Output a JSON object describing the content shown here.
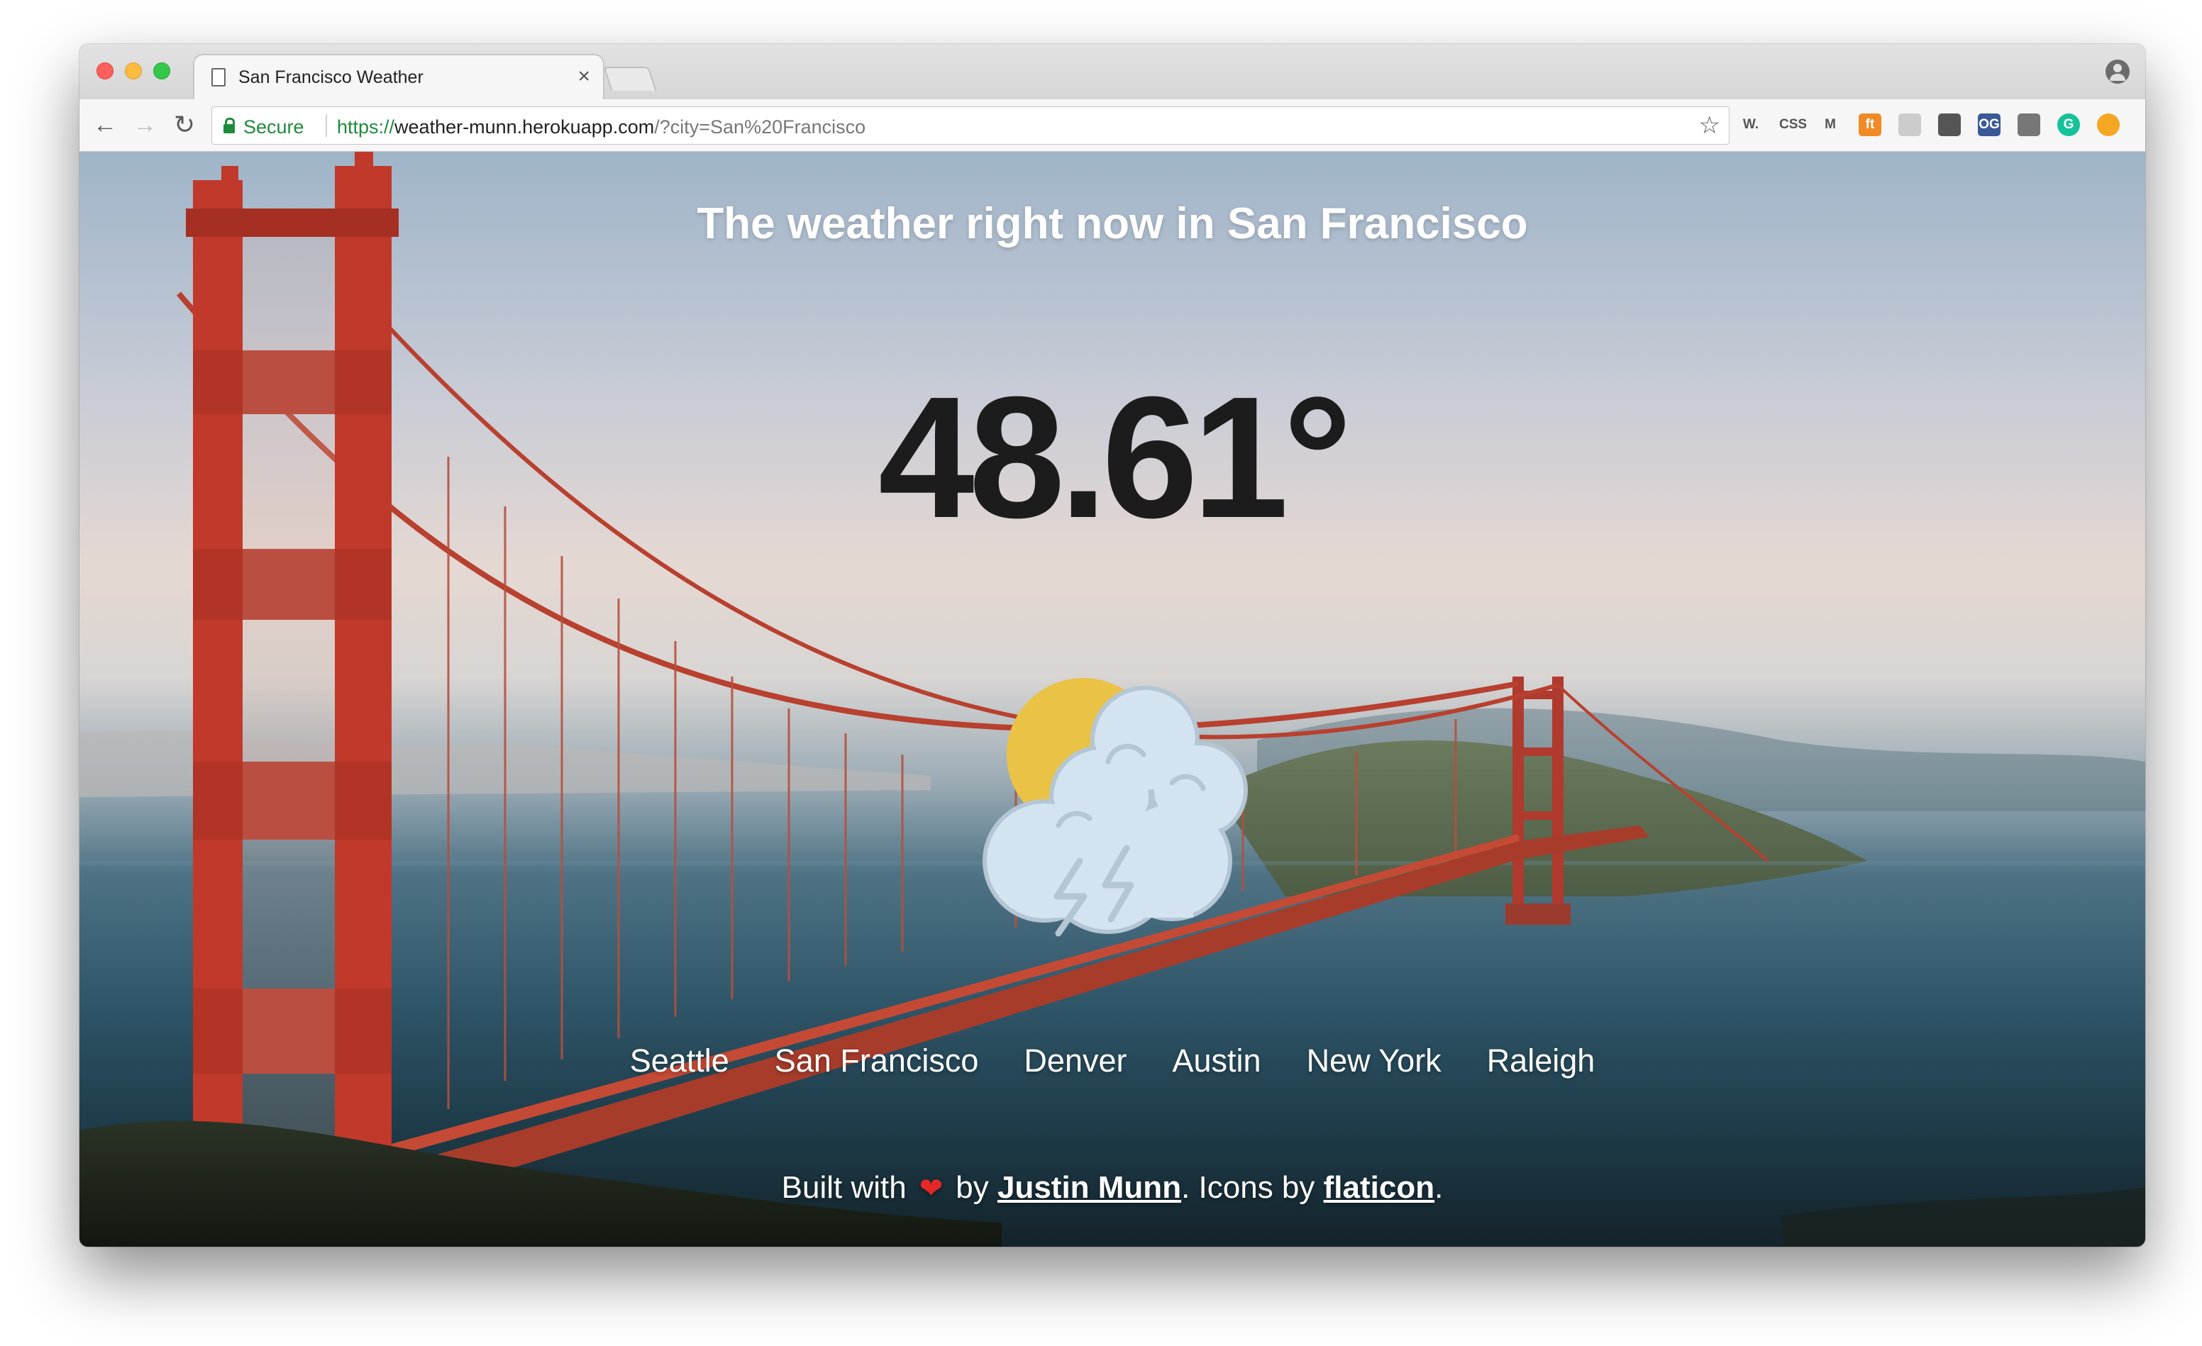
{
  "browser": {
    "tab": {
      "title": "San Francisco Weather",
      "close_glyph": "×"
    },
    "nav": {
      "back_glyph": "←",
      "forward_glyph": "→",
      "reload_glyph": "↻"
    },
    "address": {
      "secure_label": "Secure",
      "url_scheme": "https://",
      "url_host": "weather-munn.herokuapp.com",
      "url_path": "/?city=San%20Francisco"
    },
    "star_glyph": "☆",
    "extensions": [
      {
        "name": "whatfont-extension-icon",
        "label": "W.",
        "color": "#555555"
      },
      {
        "name": "css-extension-icon",
        "label": "CSS",
        "color": "#555555"
      },
      {
        "name": "m-extension-icon",
        "label": "M",
        "color": "#555555"
      },
      {
        "name": "orange-extension-icon",
        "label": "ft",
        "color": "#f08a24"
      },
      {
        "name": "grid-extension-icon",
        "label": "",
        "color": "#cccccc"
      },
      {
        "name": "rocket-extension-icon",
        "label": "",
        "color": "#555555"
      },
      {
        "name": "og-extension-icon",
        "label": "OG",
        "color": "#3b5998"
      },
      {
        "name": "camera-extension-icon",
        "label": "",
        "color": "#777777"
      },
      {
        "name": "grammarly-extension-icon",
        "label": "G",
        "color": "#15c39a"
      },
      {
        "name": "update-extension-icon",
        "label": "",
        "color": "#f5a623"
      }
    ]
  },
  "page": {
    "title": "The weather right now in San Francisco",
    "temperature": "48.61°",
    "weather_icon": "partly-cloudy-thunderstorm-icon",
    "cities": [
      "Seattle",
      "San Francisco",
      "Denver",
      "Austin",
      "New York",
      "Raleigh"
    ],
    "footer": {
      "built_with": "Built with",
      "heart": "❤",
      "by": "by",
      "author": "Justin Munn",
      "icons_by": ". Icons by",
      "icons_source": "flaticon",
      "end": "."
    }
  },
  "colors": {
    "bridge": "#c0392b",
    "sun": "#e9c246",
    "cloud": "#d3e3f0",
    "cloud_outline": "#b4c6d4"
  }
}
